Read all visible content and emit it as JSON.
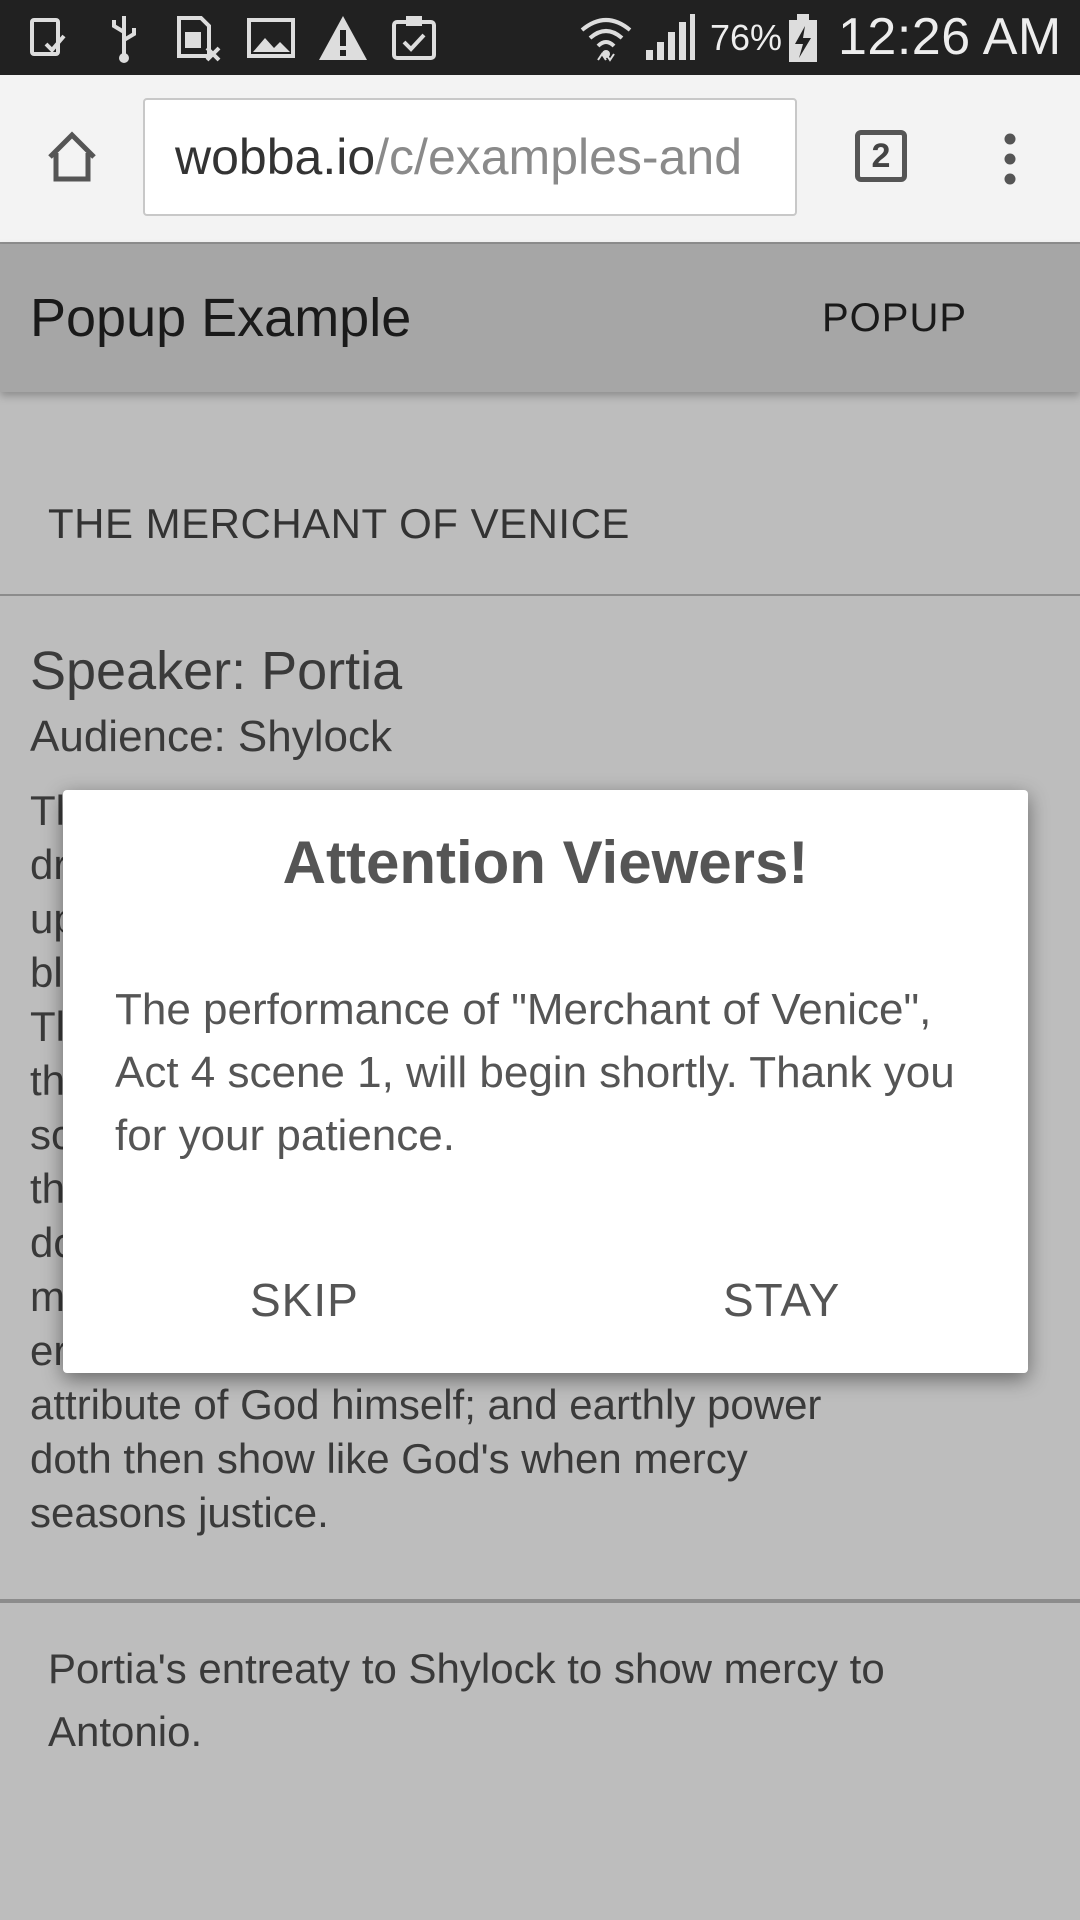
{
  "status_bar": {
    "battery_percent": "76%",
    "time": "12:26 AM",
    "icons": [
      "screenshot-icon",
      "usb-icon",
      "sim-card-icon",
      "image-icon",
      "warning-icon",
      "clipboard-check-icon",
      "wifi-icon",
      "signal-icon",
      "battery-charging-icon"
    ]
  },
  "browser": {
    "url_host": "wobba.io",
    "url_path": "/c/examples-and",
    "tab_count": "2"
  },
  "app_bar": {
    "title": "Popup Example",
    "action": "POPUP"
  },
  "content": {
    "play_title": "THE MERCHANT OF VENICE",
    "speaker": "Speaker: Portia",
    "audience": "Audience: Shylock",
    "speech_lines": [
      "Tl",
      "dr",
      "up",
      "bl",
      "Tl",
      "th",
      "sc",
      "th",
      "dc",
      "m",
      "er",
      "attribute of God himself; and earthly power",
      "doth then show like God's when mercy",
      "seasons justice."
    ],
    "summary": "Portia's entreaty to Shylock to show mercy to Antonio."
  },
  "dialog": {
    "title": "Attention Viewers!",
    "body": "The performance of \"Merchant of Venice\", Act 4 scene 1, will begin shortly. Thank you for your patience.",
    "skip_label": "SKIP",
    "stay_label": "STAY"
  },
  "colors": {
    "scrim_background": "#bdbdbd",
    "status_bar": "#212121",
    "dialog_background": "#ffffff",
    "dialog_text": "#555555"
  }
}
